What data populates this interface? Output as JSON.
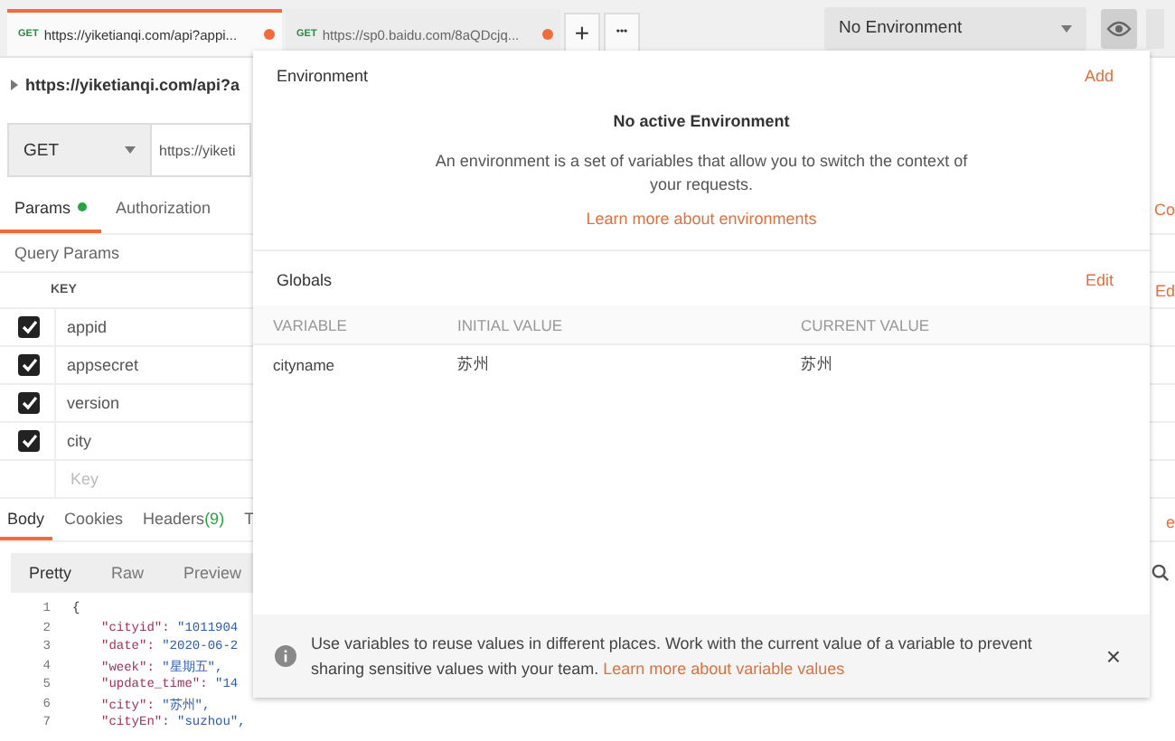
{
  "tabs": [
    {
      "method": "GET",
      "label": "https://yiketianqi.com/api?appi...",
      "selected": true,
      "modified": true
    },
    {
      "method": "GET",
      "label": "https://sp0.baidu.com/8aQDcjq...",
      "selected": false,
      "modified": true
    }
  ],
  "tab_actions": {
    "add": "+",
    "more": "•••"
  },
  "environment": {
    "value": "No Environment"
  },
  "request": {
    "title": "https://yiketianqi.com/api?a",
    "method": "GET",
    "url": "https://yiketi"
  },
  "request_tabs": [
    {
      "label": "Params",
      "selected": true,
      "indicator": true
    },
    {
      "label": "Authorization",
      "selected": false,
      "indicator": false
    }
  ],
  "right_fragments": {
    "request_tab": "Co",
    "params": "Ed",
    "response_tab": "e"
  },
  "query_params": {
    "title": "Query Params",
    "column": "KEY",
    "rows": [
      {
        "key": "appid",
        "checked": true
      },
      {
        "key": "appsecret",
        "checked": true
      },
      {
        "key": "version",
        "checked": true
      },
      {
        "key": "city",
        "checked": true
      }
    ],
    "placeholder": "Key"
  },
  "response_tabs": [
    {
      "label": "Body",
      "selected": true
    },
    {
      "label": "Cookies",
      "selected": false
    },
    {
      "label": "Headers",
      "count": "(9)",
      "selected": false
    },
    {
      "label": "T",
      "selected": false
    }
  ],
  "view_modes": [
    {
      "label": "Pretty",
      "selected": true
    },
    {
      "label": "Raw",
      "selected": false
    },
    {
      "label": "Preview",
      "selected": false
    }
  ],
  "code": [
    {
      "num": "1",
      "text": "{"
    },
    {
      "num": "2",
      "key": "\"cityid\": ",
      "value": "\"1011904"
    },
    {
      "num": "3",
      "key": "\"date\": ",
      "value": "\"2020-06-2"
    },
    {
      "num": "4",
      "key": "\"week\": ",
      "value": "\"星期五\","
    },
    {
      "num": "5",
      "key": "\"update_time\": ",
      "value": "\"14"
    },
    {
      "num": "6",
      "key": "\"city\": ",
      "value": "\"苏州\","
    },
    {
      "num": "7",
      "key": "\"cityEn\": ",
      "value": "\"suzhou\","
    }
  ],
  "popup": {
    "environment_title": "Environment",
    "add": "Add",
    "empty_title": "No active Environment",
    "empty_text": "An environment is a set of variables that allow you to switch the context of your requests.",
    "empty_link": "Learn more about environments",
    "globals_title": "Globals",
    "edit": "Edit",
    "columns": [
      "VARIABLE",
      "INITIAL VALUE",
      "CURRENT VALUE"
    ],
    "rows": [
      [
        "cityname",
        "苏州",
        "苏州"
      ]
    ],
    "info_text": "Use variables to reuse values in different places. Work with the current value of a variable to prevent sharing sensitive values with your team.",
    "info_link": "Learn more about variable values",
    "close": "×"
  }
}
